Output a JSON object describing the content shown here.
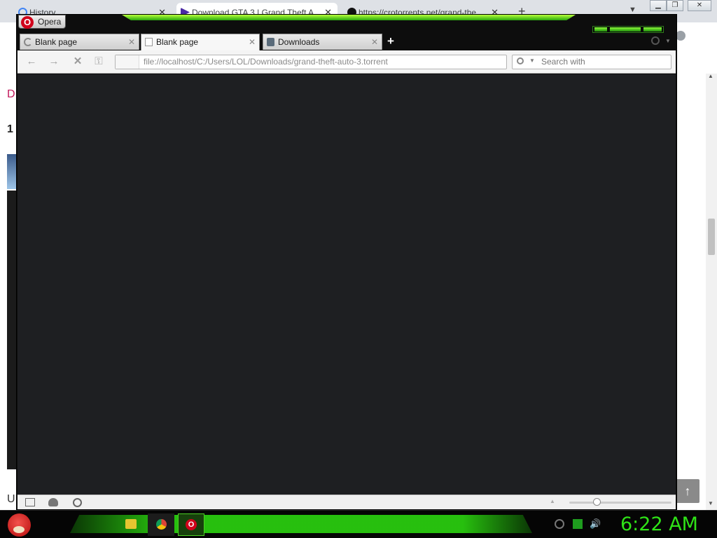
{
  "background_window": {
    "tabs": [
      {
        "title": "History"
      },
      {
        "title": "Download GTA 3 | Grand Theft A"
      },
      {
        "title": "https://crotorrents.net/grand-the"
      }
    ],
    "page_fragments": {
      "top": "D",
      "heading": "1",
      "bottom": "U"
    }
  },
  "opera": {
    "menu_label": "Opera",
    "tabs": [
      {
        "title": "Blank page",
        "loading": true
      },
      {
        "title": "Blank page",
        "active": true
      },
      {
        "title": "Downloads"
      }
    ],
    "address": "file://localhost/C:/Users/LOL/Downloads/grand-theft-auto-3.torrent",
    "search_placeholder": "Search with"
  },
  "taskbar": {
    "apps": [
      "explorer-icon",
      "chrome-icon",
      "opera-icon"
    ],
    "clock": "6:22 AM"
  },
  "colors": {
    "accent_green": "#2fe217",
    "content_bg": "#1e1f22",
    "opera_red": "#d0021b"
  }
}
